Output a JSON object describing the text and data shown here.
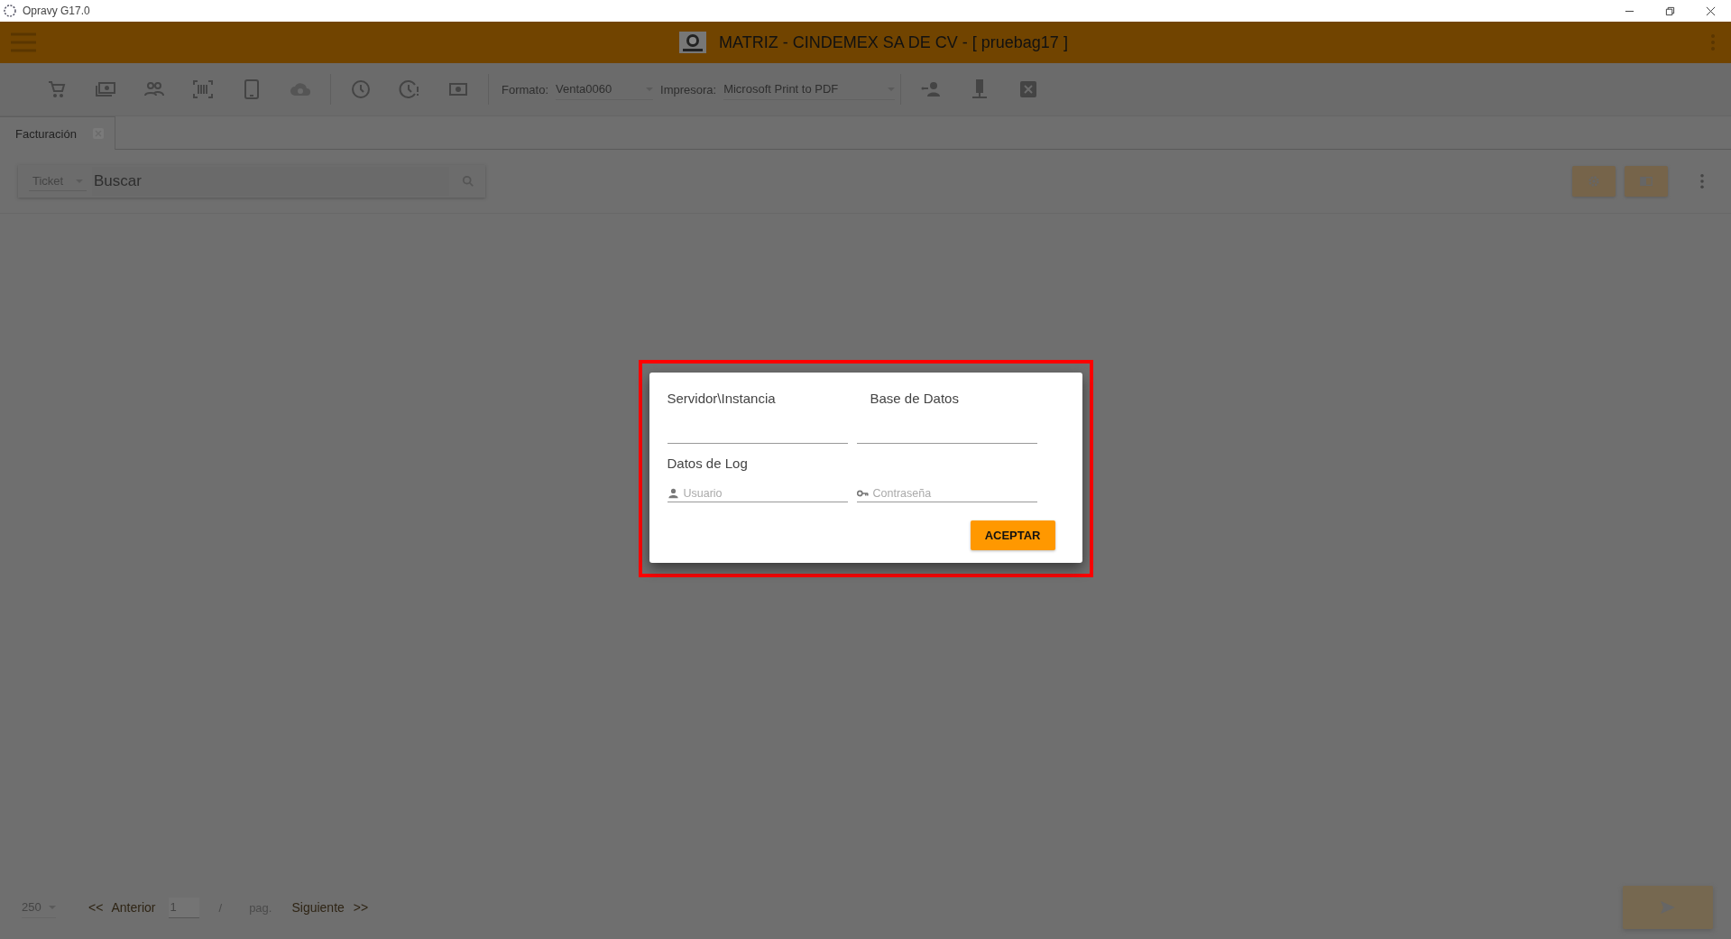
{
  "title_bar": {
    "title": "Opravy G17.0"
  },
  "header": {
    "title": "MATRIZ - CINDEMEX SA DE CV - [ pruebag17 ]"
  },
  "toolbar": {
    "formato_label": "Formato:",
    "formato_value": "Venta0060",
    "impresora_label": "Impresora:",
    "impresora_value": "Microsoft Print to PDF"
  },
  "tabs": [
    {
      "label": "Facturación",
      "selected": true
    }
  ],
  "search": {
    "type_value": "Ticket",
    "placeholder": "Buscar"
  },
  "dialog": {
    "fields": [
      {
        "label": "Servidor\\Instancia"
      },
      {
        "label": "Base de Datos"
      }
    ],
    "section_title": "Datos de Log",
    "login_fields": [
      {
        "kind": "user",
        "placeholder": "Usuario"
      },
      {
        "kind": "password",
        "placeholder": "Contraseña"
      }
    ],
    "button": "ACEPTAR"
  },
  "pagination": {
    "page_size": "250",
    "prev_arrows": "<<",
    "prev": "Anterior",
    "page": "1",
    "separator": "/",
    "pag_label": "pag.",
    "next": "Siguiente",
    "next_arrows": ">>"
  }
}
